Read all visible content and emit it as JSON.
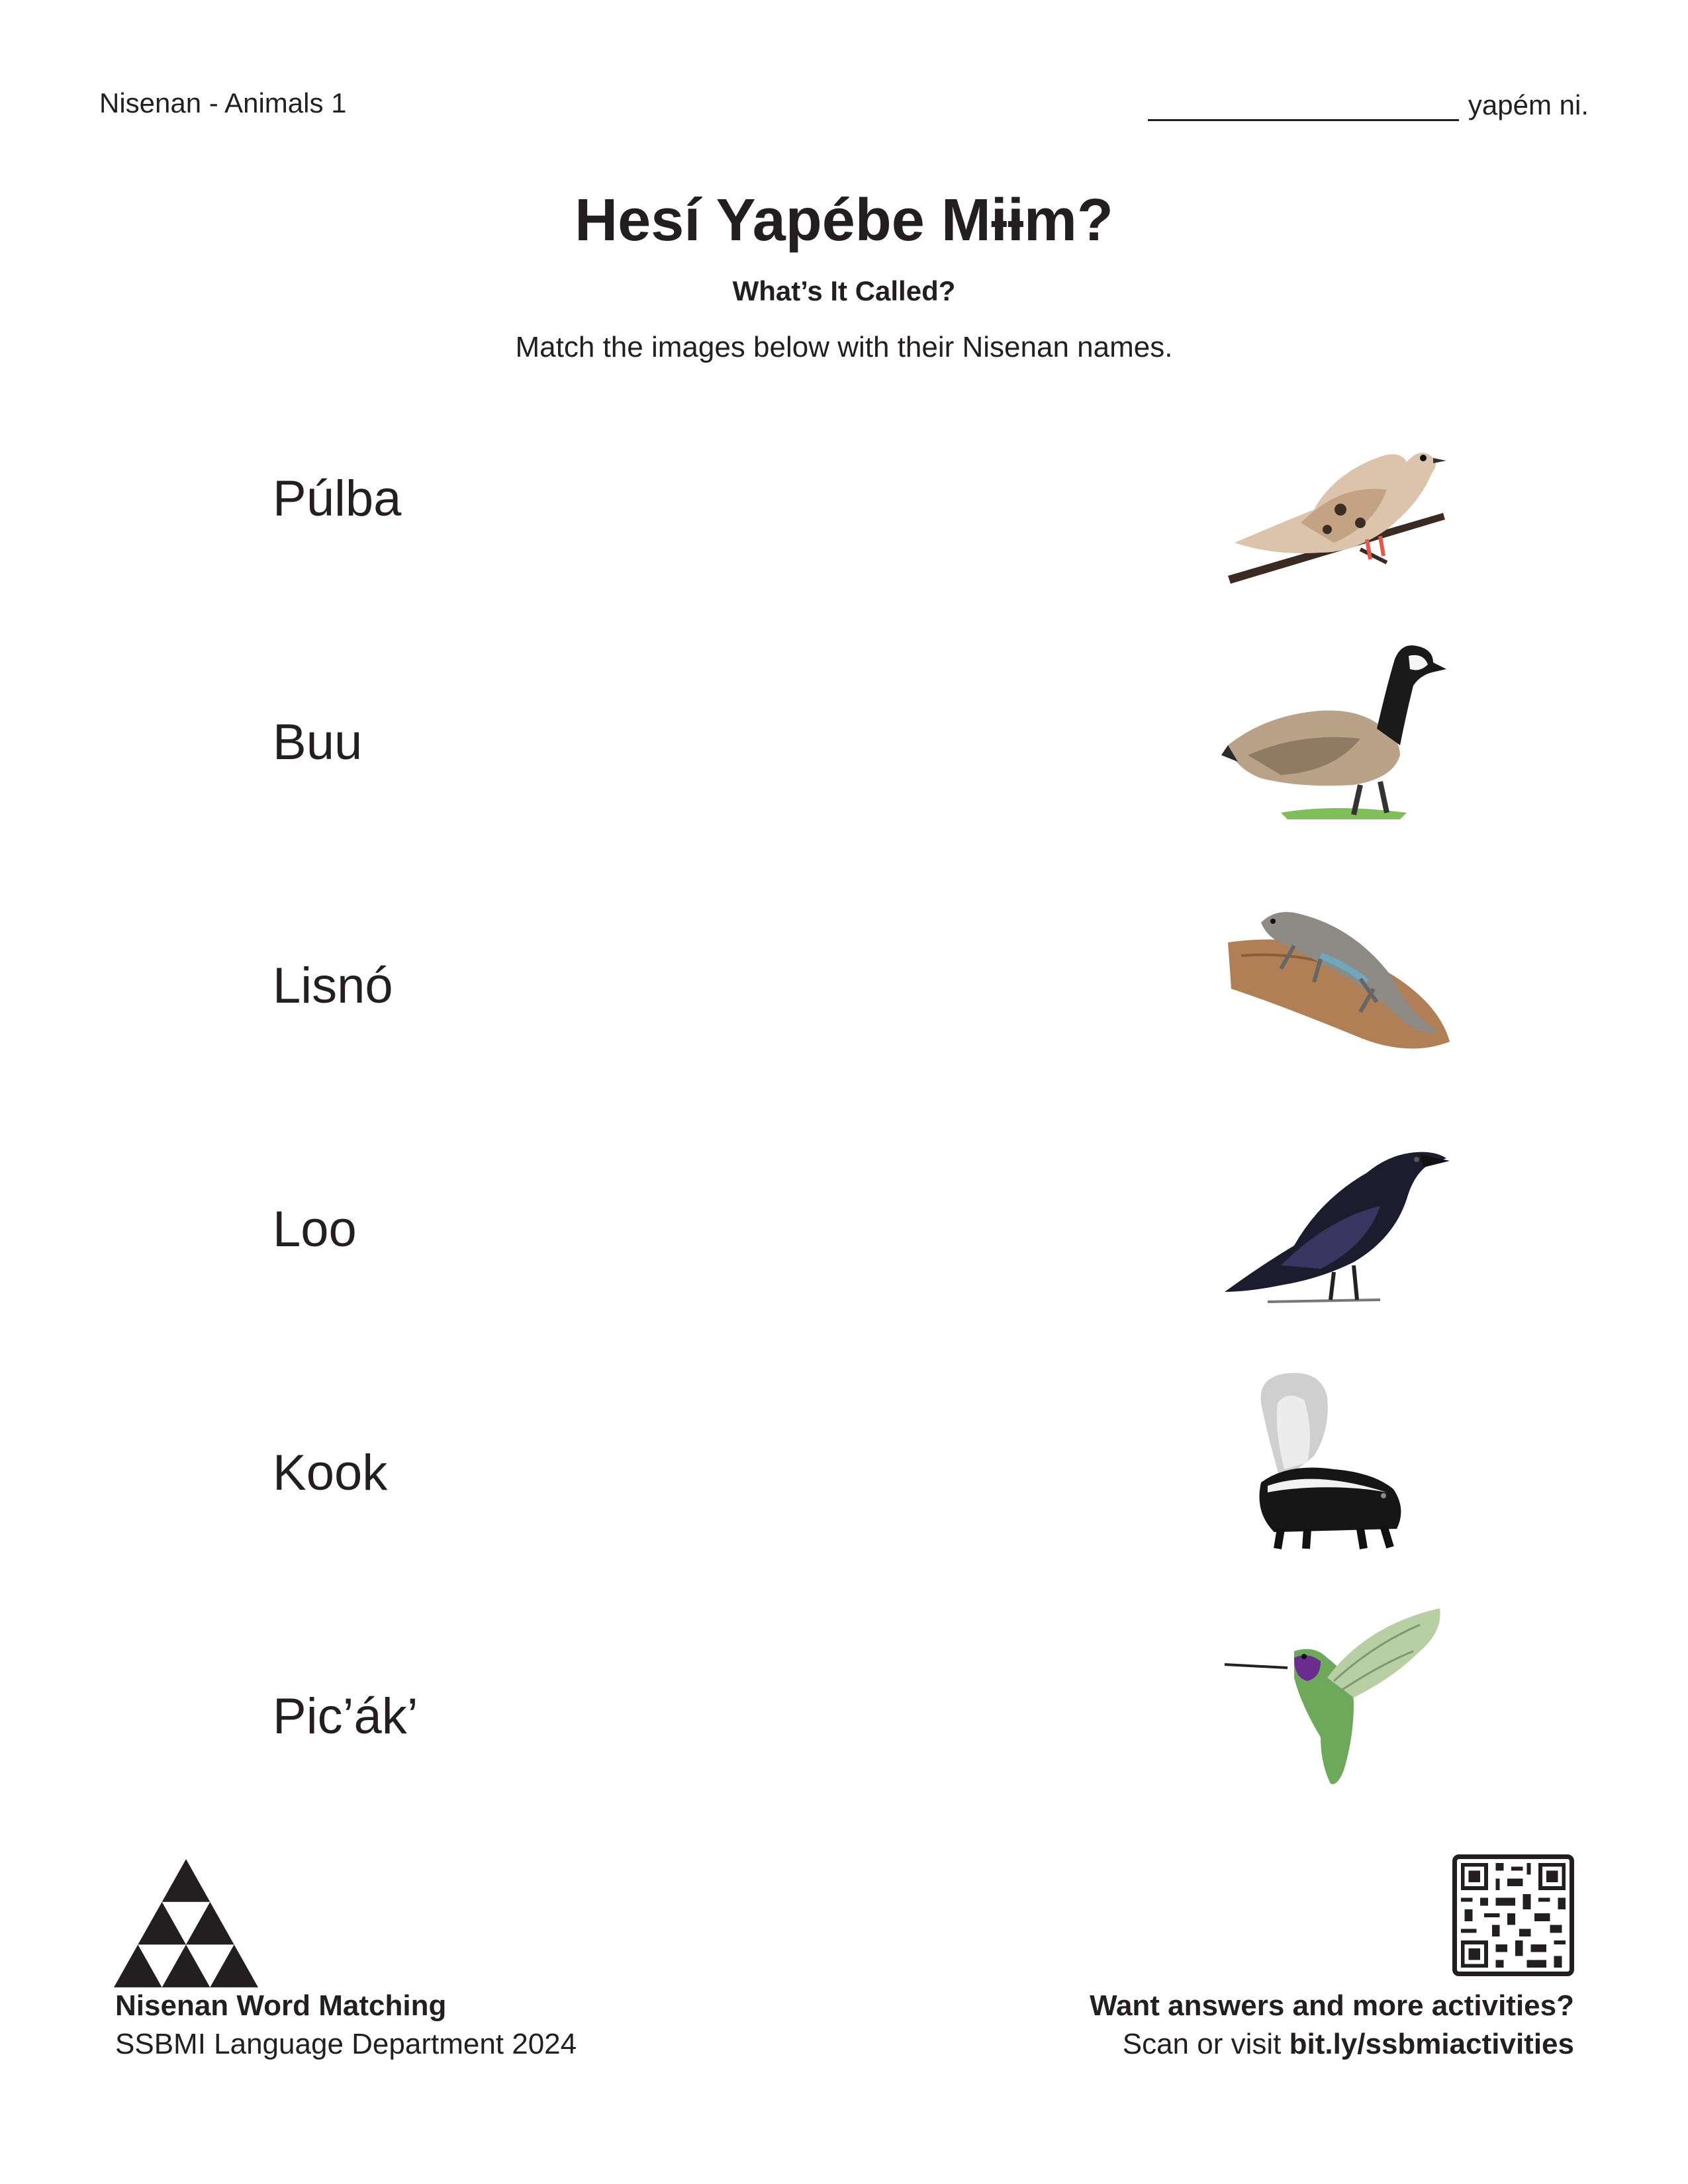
{
  "header": {
    "worksheet_title": "Nisenan - Animals 1",
    "name_suffix": "yapém ni."
  },
  "title": "Hesí Yapébe Mɨɨm?",
  "subtitle": "What’s It Called?",
  "instructions": "Match the images below with their Nisenan names.",
  "words": [
    "Púlba",
    "Buu",
    "Lisnó",
    "Loo",
    "Kook",
    "Pic’ák’"
  ],
  "images": [
    {
      "icon": "dove-icon"
    },
    {
      "icon": "goose-icon"
    },
    {
      "icon": "lizard-icon"
    },
    {
      "icon": "raven-icon"
    },
    {
      "icon": "skunk-icon"
    },
    {
      "icon": "hummingbird-icon"
    }
  ],
  "footer": {
    "left_title": "Nisenan Word Matching",
    "left_subtitle": "SSBMI Language Department 2024",
    "right_title": "Want answers and more activities?",
    "right_prefix": "Scan or visit ",
    "right_link": "bit.ly/ssbmiactivities"
  },
  "colors": {
    "text": "#231f20",
    "logo": "#231f20"
  }
}
